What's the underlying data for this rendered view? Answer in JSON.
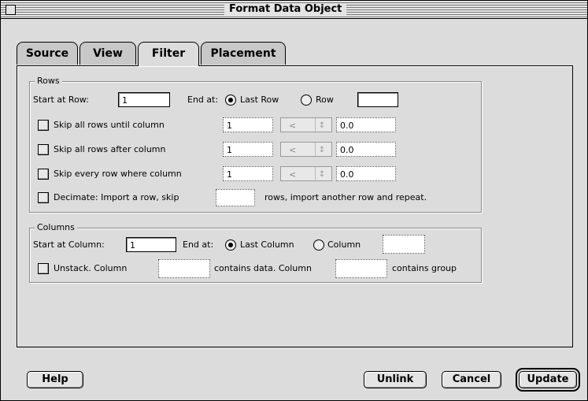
{
  "window": {
    "title": "Format Data Object"
  },
  "tabs": [
    {
      "label": "Source",
      "active": false
    },
    {
      "label": "View",
      "active": false
    },
    {
      "label": "Filter",
      "active": true
    },
    {
      "label": "Placement",
      "active": false
    }
  ],
  "rows": {
    "legend": "Rows",
    "start_label": "Start at Row:",
    "start_value": "1",
    "end_label": "End at:",
    "last_row_label": "Last Row",
    "row_label": "Row",
    "row_value": "",
    "skip_until_label": "Skip all rows until column",
    "skip_until_col": "1",
    "skip_until_op": "<",
    "skip_until_val": "0.0",
    "skip_after_label": "Skip all rows after column",
    "skip_after_col": "1",
    "skip_after_op": "<",
    "skip_after_val": "0.0",
    "skip_every_label": "Skip every row where column",
    "skip_every_col": "1",
    "skip_every_op": "<",
    "skip_every_val": "0.0",
    "decimate_label": "Decimate: Import a row, skip",
    "decimate_value": "",
    "decimate_suffix": "rows, import another row and repeat."
  },
  "columns": {
    "legend": "Columns",
    "start_label": "Start at Column:",
    "start_value": "1",
    "end_label": "End at:",
    "last_col_label": "Last Column",
    "col_label": "Column",
    "col_value": "",
    "unstack_label": "Unstack.  Column",
    "unstack_data_value": "",
    "contains_data_label": "contains data.  Column",
    "unstack_group_value": "",
    "contains_group_label": "contains group"
  },
  "buttons": {
    "help": "Help",
    "unlink": "Unlink",
    "cancel": "Cancel",
    "update": "Update"
  },
  "icons": {
    "popup_arrows": "↕"
  }
}
